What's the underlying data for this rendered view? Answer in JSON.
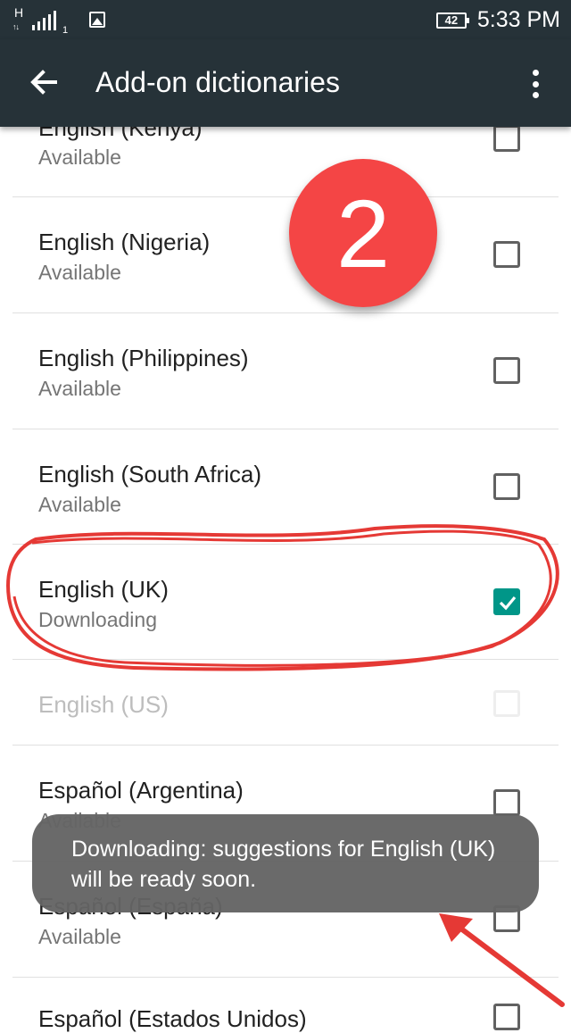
{
  "status_bar": {
    "network": "H",
    "sim": "1",
    "battery": "42",
    "time": "5:33 PM"
  },
  "app_bar": {
    "title": "Add-on dictionaries",
    "back_icon": "arrow-left-icon",
    "menu_icon": "more-vert-icon"
  },
  "items": [
    {
      "title": "English (Kenya)",
      "status": "Available",
      "checked": false,
      "enabled": true
    },
    {
      "title": "English (Nigeria)",
      "status": "Available",
      "checked": false,
      "enabled": true
    },
    {
      "title": "English (Philippines)",
      "status": "Available",
      "checked": false,
      "enabled": true
    },
    {
      "title": "English (South Africa)",
      "status": "Available",
      "checked": false,
      "enabled": true
    },
    {
      "title": "English (UK)",
      "status": "Downloading",
      "checked": true,
      "enabled": true
    },
    {
      "title": "English (US)",
      "status": "",
      "checked": false,
      "enabled": false
    },
    {
      "title": "Español (Argentina)",
      "status": "Available",
      "checked": false,
      "enabled": true
    },
    {
      "title": "Español (España)",
      "status": "Available",
      "checked": false,
      "enabled": true
    },
    {
      "title": "Español (Estados Unidos)",
      "status": "",
      "checked": false,
      "enabled": true
    }
  ],
  "annotation": {
    "step_number": "2",
    "badge_color": "#f44545",
    "highlight_color": "#e53935"
  },
  "toast": {
    "line1": "Downloading: suggestions for English (UK)",
    "line2": "will be ready soon."
  },
  "colors": {
    "app_bar": "#263238",
    "checkbox_checked": "#009688"
  }
}
